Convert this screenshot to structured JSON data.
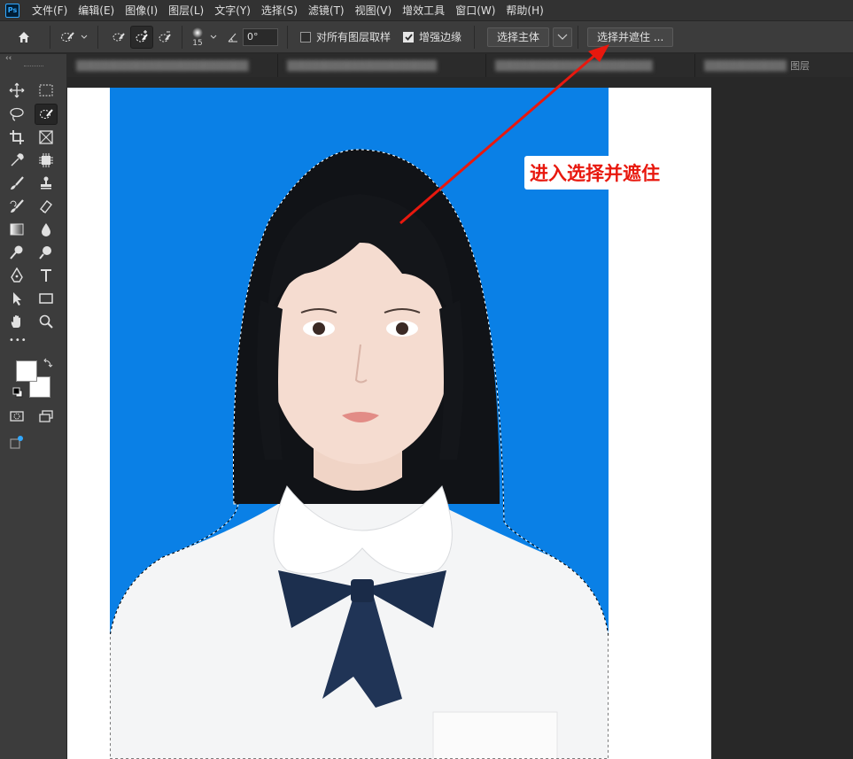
{
  "app": {
    "logo": "Ps"
  },
  "menu": [
    "文件(F)",
    "编辑(E)",
    "图像(I)",
    "图层(L)",
    "文字(Y)",
    "选择(S)",
    "滤镜(T)",
    "视图(V)",
    "增效工具",
    "窗口(W)",
    "帮助(H)"
  ],
  "options": {
    "brush_size": "15",
    "angle": "0°",
    "sample_all_layers": {
      "label": "对所有图层取样",
      "checked": false
    },
    "enhance_edge": {
      "label": "增强边缘",
      "checked": true
    },
    "select_subject": "选择主体",
    "select_and_mask": "选择并遮住 ..."
  },
  "tabs": [
    {
      "label": "图层"
    }
  ],
  "toolbar": {
    "collapse": "‹‹",
    "more": "•••"
  },
  "annotation": {
    "text": "进入选择并遮住",
    "color": "#e8180e"
  },
  "colors": {
    "photo_background": "#0a80e6",
    "foreground_swatch": "#ffffff",
    "background_swatch": "#ffffff"
  }
}
